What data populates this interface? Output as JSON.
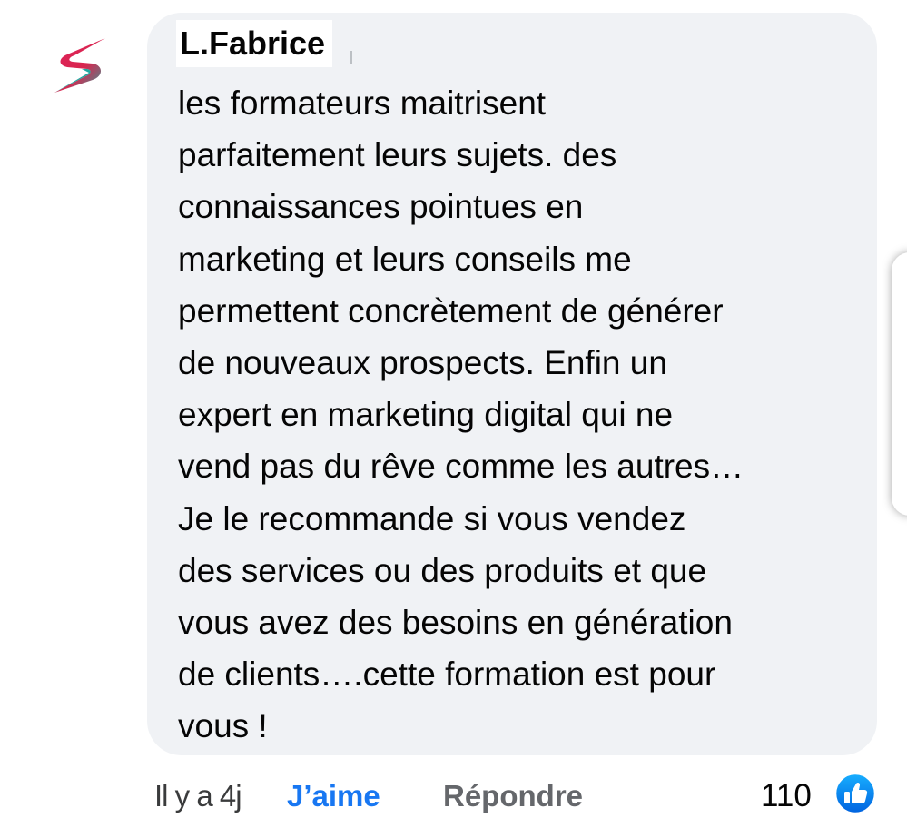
{
  "comment": {
    "avatar_icon": "brand-s-logo-icon",
    "author": "L.Fabrice",
    "text": "les formateurs maitrisent\nparfaitement leurs sujets. des\nconnaissances pointues en\nmarketing  et leurs conseils me\npermettent concrètement de générer\nde nouveaux prospects. Enfin un\nexpert en marketing digital qui ne\nvend pas du rêve comme les autres…\nJe le recommande si vous vendez\ndes services ou des produits et que\nvous avez des besoins en génération\nde clients….cette formation est pour\nvous !",
    "time": "Il y a 4j",
    "like_label": "J’aime",
    "reply_label": "Répondre",
    "reaction_count": "110",
    "reaction_icon": "thumbs-up-icon"
  },
  "colors": {
    "bubble": "#f0f2f5",
    "like_blue": "#1877f2",
    "reply_gray": "#65676b",
    "logo_magenta": "#e0245e",
    "logo_teal": "#1fa8a0"
  }
}
